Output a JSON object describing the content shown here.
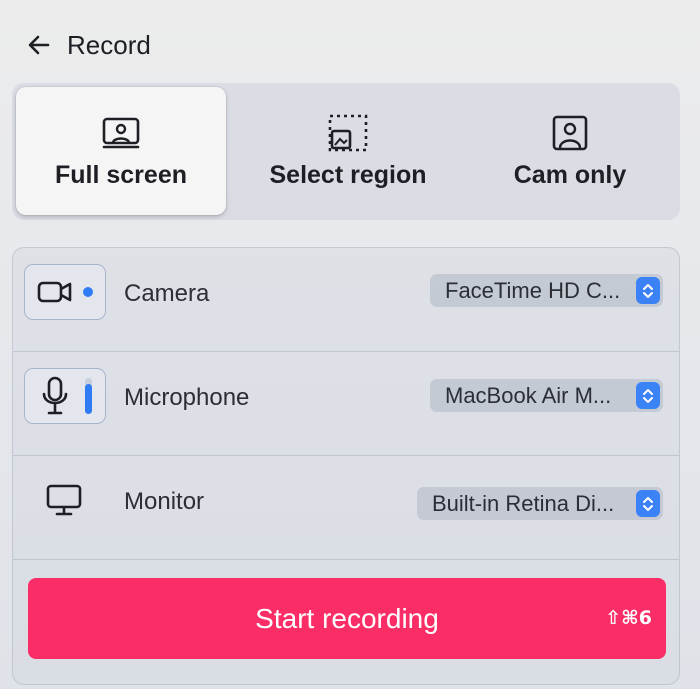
{
  "header": {
    "title": "Record",
    "back_icon": "arrow-left-icon"
  },
  "modes": [
    {
      "label": "Full screen",
      "icon": "monitor-user-icon",
      "selected": true
    },
    {
      "label": "Select region",
      "icon": "region-select-icon",
      "selected": false
    },
    {
      "label": "Cam only",
      "icon": "user-frame-icon",
      "selected": false
    }
  ],
  "devices": {
    "camera": {
      "label": "Camera",
      "icon": "video-camera-icon",
      "value": "FaceTime HD C...",
      "active": true
    },
    "microphone": {
      "label": "Microphone",
      "icon": "microphone-icon",
      "value": "MacBook Air M...",
      "active": true
    },
    "monitor": {
      "label": "Monitor",
      "icon": "monitor-icon",
      "value": "Built-in Retina Di..."
    }
  },
  "record_button": {
    "label": "Start recording",
    "shortcut": "⇧⌘6"
  },
  "colors": {
    "accent": "#fb2d66",
    "stepper": "#3a82f6",
    "indicator": "#2f7bf6"
  }
}
